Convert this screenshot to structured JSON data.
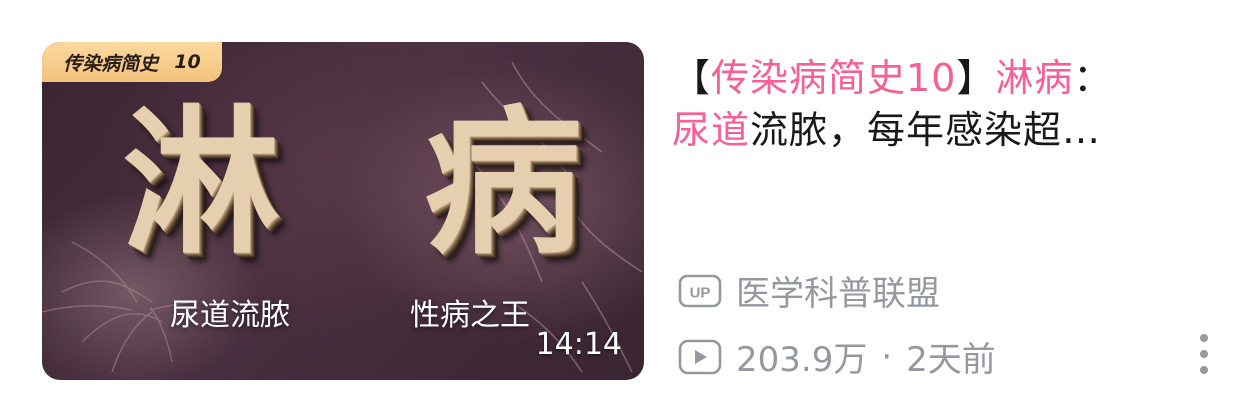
{
  "thumbnail": {
    "series_label": "传染病简史",
    "series_number": "10",
    "big_title_chars": [
      "淋",
      "病"
    ],
    "subtitle_left": "尿道流脓",
    "subtitle_right": "性病之王",
    "duration": "14:14"
  },
  "title": {
    "bracket_open": "【",
    "series": "传染病简史10",
    "bracket_close": "】",
    "disease": "淋病",
    "colon": "：",
    "keyword": "尿道",
    "rest": "流脓，每年感染超…"
  },
  "author": {
    "badge_icon": "up-badge-icon",
    "badge_text": "UP",
    "name": "医学科普联盟"
  },
  "stats": {
    "play_icon": "play-count-icon",
    "views": "203.9万",
    "separator": "·",
    "time_ago": "2天前"
  },
  "menu": {
    "icon": "more-vertical-icon"
  },
  "colors": {
    "highlight": "#fb5d95",
    "title_text": "#18191c",
    "meta_text": "#9499a0",
    "tag_bg": "#f3c27c"
  }
}
